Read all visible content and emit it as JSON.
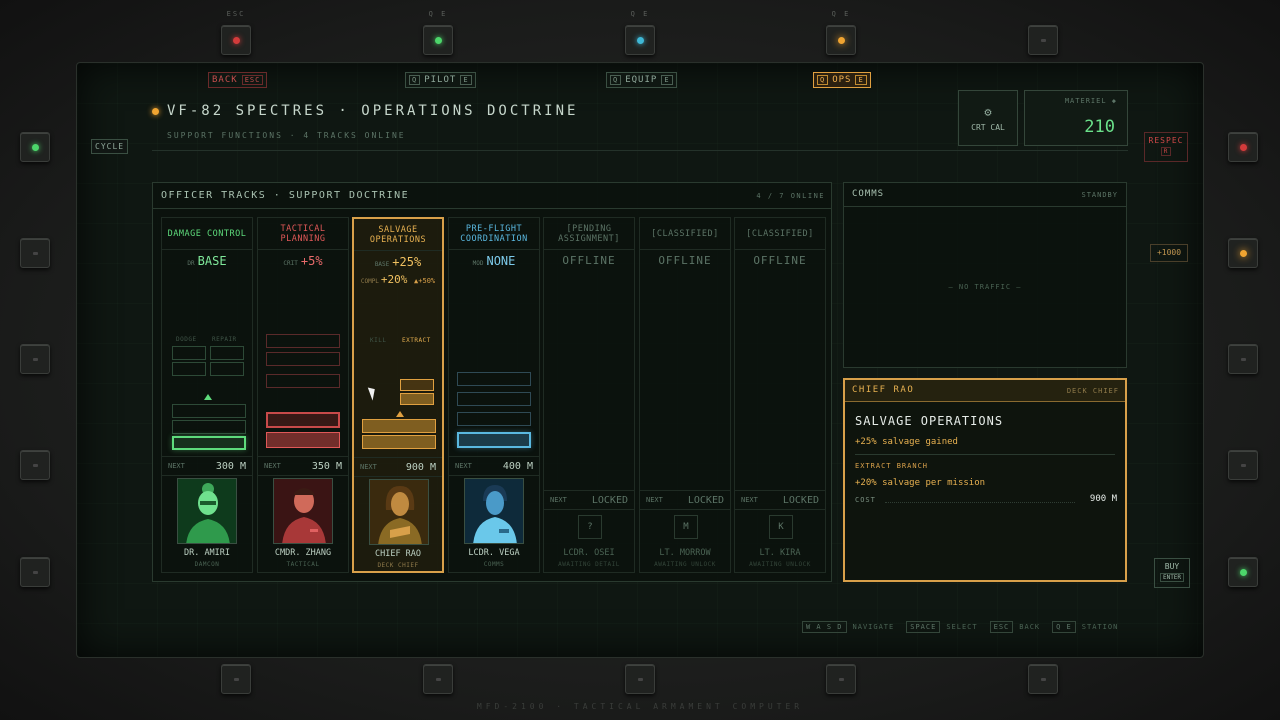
{
  "top_keys": {
    "back_key": "ESC",
    "pilot_key": "Q E",
    "equip_key": "Q E",
    "ops_key": "Q E"
  },
  "tabs": {
    "back": {
      "label": "BACK",
      "key": "ESC"
    },
    "pilot": {
      "label": "PILOT",
      "key_l": "Q",
      "key_r": "E"
    },
    "equip": {
      "label": "EQUIP",
      "key_l": "Q",
      "key_r": "E"
    },
    "ops": {
      "label": "OPS",
      "key_l": "Q",
      "key_r": "E"
    }
  },
  "cycle_label": "CYCLE",
  "header": {
    "title": "VF-82 SPECTRES · OPERATIONS DOCTRINE",
    "subtitle": "SUPPORT FUNCTIONS · 4 TRACKS ONLINE",
    "crt_cal": "CRT CAL",
    "materiel_label": "MATERIEL ◆",
    "materiel_value": "210"
  },
  "respec": {
    "label": "RESPEC",
    "key": "R"
  },
  "plus1000": "+1000",
  "buy": {
    "label": "BUY",
    "key": "ENTER"
  },
  "tracks": {
    "title": "OFFICER TRACKS · SUPPORT DOCTRINE",
    "count": "4 / 7 ONLINE",
    "columns": [
      {
        "head": "DAMAGE CONTROL",
        "stat_mini": "DR",
        "stat": "BASE",
        "branch_l": "DODGE",
        "branch_r": "REPAIR",
        "next_label": "NEXT",
        "cost": "300 M",
        "name": "DR. AMIRI",
        "role": "DAMCON"
      },
      {
        "head": "TACTICAL PLANNING",
        "stat_mini": "CRIT",
        "stat": "+5%",
        "next_label": "NEXT",
        "cost": "350 M",
        "name": "CMDR. ZHANG",
        "role": "TACTICAL"
      },
      {
        "head": "SALVAGE OPERATIONS",
        "stat_mini": "BASE",
        "stat": "+25%",
        "stat2_mini": "COMPL",
        "stat2": "+20%",
        "stat2_up": "▲+50%",
        "branch_l": "KILL",
        "branch_r": "EXTRACT",
        "next_label": "NEXT",
        "cost": "900 M",
        "name": "CHIEF RAO",
        "role": "DECK CHIEF"
      },
      {
        "head": "PRE-FLIGHT COORDINATION",
        "stat_mini": "MOD",
        "stat": "NONE",
        "next_label": "NEXT",
        "cost": "400 M",
        "name": "LCDR. VEGA",
        "role": "COMMS"
      },
      {
        "head": "[PENDING ASSIGNMENT]",
        "status": "OFFLINE",
        "next_label": "NEXT",
        "cost": "LOCKED",
        "slot": "?",
        "name": "LCDR. OSEI",
        "role": "AWAITING DETAIL"
      },
      {
        "head": "[CLASSIFIED]",
        "status": "OFFLINE",
        "next_label": "NEXT",
        "cost": "LOCKED",
        "slot": "M",
        "name": "LT. MORROW",
        "role": "AWAITING UNLOCK"
      },
      {
        "head": "[CLASSIFIED]",
        "status": "OFFLINE",
        "next_label": "NEXT",
        "cost": "LOCKED",
        "slot": "K",
        "name": "LT. KIRA",
        "role": "AWAITING UNLOCK"
      }
    ]
  },
  "comms": {
    "title": "COMMS",
    "status": "STANDBY",
    "message": "— NO TRAFFIC —"
  },
  "detail": {
    "officer": "CHIEF RAO",
    "role": "DECK CHIEF",
    "track": "SALVAGE OPERATIONS",
    "line1": "+25% salvage gained",
    "branch_title": "EXTRACT BRANCH",
    "line2": "+20% salvage per mission",
    "cost_label": "COST",
    "cost_value": "900 M"
  },
  "hints": {
    "nav_key": "W A S D",
    "nav": "NAVIGATE",
    "select_key": "SPACE",
    "select": "SELECT",
    "back_key": "ESC",
    "back": "BACK",
    "station_key": "Q E",
    "station": "STATION"
  },
  "brand": "MFD-2100 · TACTICAL ARMAMENT COMPUTER",
  "colors": {
    "accent_amber": "#e0a040",
    "green": "#5edb7c",
    "red": "#e05858",
    "cyan": "#5ab8e0"
  }
}
